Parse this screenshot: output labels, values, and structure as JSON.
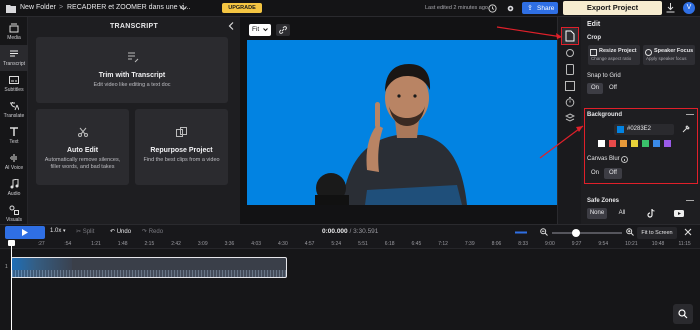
{
  "topbar": {
    "folder": "New Folder",
    "separator": ">",
    "project_title": "RECADRER et ZOOMER dans une vi...",
    "upgrade_label": "UPGRADE",
    "last_edited": "Last edited 2 minutes ago",
    "share_label": "Share",
    "export_label": "Export Project",
    "avatar_letter": "V"
  },
  "rail": {
    "items": [
      {
        "label": "Media",
        "icon": "media-icon"
      },
      {
        "label": "Transcript",
        "icon": "transcript-icon"
      },
      {
        "label": "Subtitles",
        "icon": "subtitles-icon"
      },
      {
        "label": "Translate",
        "icon": "translate-icon"
      },
      {
        "label": "Text",
        "icon": "text-icon"
      },
      {
        "label": "AI Voice",
        "icon": "ai-voice-icon"
      },
      {
        "label": "Audio",
        "icon": "audio-icon"
      },
      {
        "label": "Visuals",
        "icon": "visuals-icon"
      }
    ]
  },
  "transcript": {
    "title": "TRANSCRIPT",
    "trim": {
      "title": "Trim with Transcript",
      "desc": "Edit video like editing a text doc"
    },
    "auto": {
      "title": "Auto Edit",
      "desc": "Automatically remove silences, filler words, and bad takes"
    },
    "repurpose": {
      "title": "Repurpose Project",
      "desc": "Find the best clips from a video"
    }
  },
  "preview": {
    "fit_label": "Fit",
    "background_color": "#0283e2"
  },
  "edit": {
    "title": "Edit",
    "crop_label": "Crop",
    "resize_title": "Resize Project",
    "resize_desc": "Change aspect ratio",
    "speaker_title": "Speaker Focus",
    "speaker_desc": "Apply speaker focus",
    "snap_label": "Snap to Grid",
    "on_label": "On",
    "off_label": "Off",
    "background_label": "Background",
    "hex_value": "#0283E2",
    "swatches": [
      "#ffffff",
      "#e84a4a",
      "#e89a3a",
      "#e8d23a",
      "#3ac26a",
      "#3a8ae8",
      "#9a5ae8"
    ],
    "canvas_blur_label": "Canvas Blur",
    "blur_on": "On",
    "blur_off": "Off",
    "safe_zones_label": "Safe Zones",
    "none_label": "None",
    "all_label": "All"
  },
  "timeline": {
    "speed": "1.0x",
    "split_label": "Split",
    "undo_label": "Undo",
    "redo_label": "Redo",
    "current_time": "0:00.000",
    "total_time": "3:30.591",
    "fit_screen_label": "Fit to Screen",
    "ticks": [
      ":0",
      ":27",
      ":54",
      "1:21",
      "1:48",
      "2:15",
      "2:42",
      "3:09",
      "3:36",
      "4:03",
      "4:30",
      "4:57",
      "5:24",
      "5:51",
      "6:18",
      "6:45",
      "7:12",
      "7:39",
      "8:06",
      "8:33",
      "9:00",
      "9:27",
      "9:54",
      "10:21",
      "10:48",
      "11:15"
    ],
    "track_label": "1"
  }
}
